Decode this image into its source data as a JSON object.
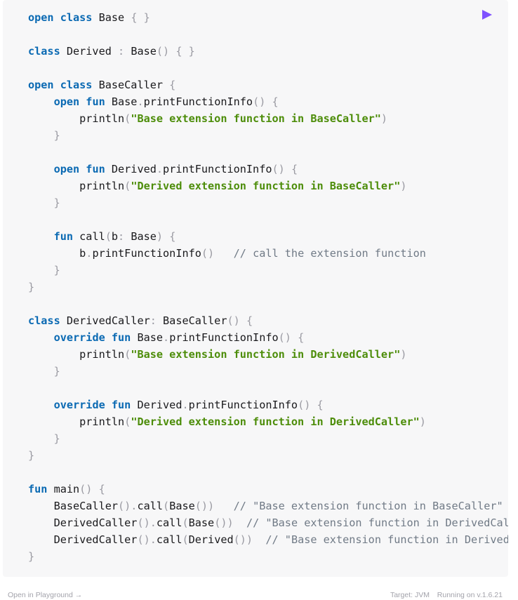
{
  "editor": {
    "run_icon": "play-triangle-icon",
    "accent_color": "#7f52ff",
    "lines": [
      [
        {
          "t": "kw",
          "v": "open class"
        },
        {
          "t": "tx",
          "v": " Base "
        },
        {
          "t": "pn",
          "v": "{ }"
        }
      ],
      [],
      [
        {
          "t": "kw",
          "v": "class"
        },
        {
          "t": "tx",
          "v": " Derived "
        },
        {
          "t": "pn",
          "v": ":"
        },
        {
          "t": "tx",
          "v": " Base"
        },
        {
          "t": "pn",
          "v": "()"
        },
        {
          "t": "tx",
          "v": " "
        },
        {
          "t": "pn",
          "v": "{ }"
        }
      ],
      [],
      [
        {
          "t": "kw",
          "v": "open class"
        },
        {
          "t": "tx",
          "v": " BaseCaller "
        },
        {
          "t": "pn",
          "v": "{"
        }
      ],
      [
        {
          "t": "tx",
          "v": "    "
        },
        {
          "t": "kw",
          "v": "open fun"
        },
        {
          "t": "tx",
          "v": " Base"
        },
        {
          "t": "pn",
          "v": "."
        },
        {
          "t": "tx",
          "v": "printFunctionInfo"
        },
        {
          "t": "pn",
          "v": "()"
        },
        {
          "t": "tx",
          "v": " "
        },
        {
          "t": "pn",
          "v": "{"
        }
      ],
      [
        {
          "t": "tx",
          "v": "        println"
        },
        {
          "t": "pn",
          "v": "("
        },
        {
          "t": "str",
          "v": "\"Base extension function in BaseCaller\""
        },
        {
          "t": "pn",
          "v": ")"
        }
      ],
      [
        {
          "t": "tx",
          "v": "    "
        },
        {
          "t": "pn",
          "v": "}"
        }
      ],
      [],
      [
        {
          "t": "tx",
          "v": "    "
        },
        {
          "t": "kw",
          "v": "open fun"
        },
        {
          "t": "tx",
          "v": " Derived"
        },
        {
          "t": "pn",
          "v": "."
        },
        {
          "t": "tx",
          "v": "printFunctionInfo"
        },
        {
          "t": "pn",
          "v": "()"
        },
        {
          "t": "tx",
          "v": " "
        },
        {
          "t": "pn",
          "v": "{"
        }
      ],
      [
        {
          "t": "tx",
          "v": "        println"
        },
        {
          "t": "pn",
          "v": "("
        },
        {
          "t": "str",
          "v": "\"Derived extension function in BaseCaller\""
        },
        {
          "t": "pn",
          "v": ")"
        }
      ],
      [
        {
          "t": "tx",
          "v": "    "
        },
        {
          "t": "pn",
          "v": "}"
        }
      ],
      [],
      [
        {
          "t": "tx",
          "v": "    "
        },
        {
          "t": "kw",
          "v": "fun"
        },
        {
          "t": "tx",
          "v": " call"
        },
        {
          "t": "pn",
          "v": "("
        },
        {
          "t": "tx",
          "v": "b"
        },
        {
          "t": "pn",
          "v": ":"
        },
        {
          "t": "tx",
          "v": " Base"
        },
        {
          "t": "pn",
          "v": ")"
        },
        {
          "t": "tx",
          "v": " "
        },
        {
          "t": "pn",
          "v": "{"
        }
      ],
      [
        {
          "t": "tx",
          "v": "        b"
        },
        {
          "t": "pn",
          "v": "."
        },
        {
          "t": "tx",
          "v": "printFunctionInfo"
        },
        {
          "t": "pn",
          "v": "()"
        },
        {
          "t": "tx",
          "v": "   "
        },
        {
          "t": "cm",
          "v": "// call the extension function"
        }
      ],
      [
        {
          "t": "tx",
          "v": "    "
        },
        {
          "t": "pn",
          "v": "}"
        }
      ],
      [
        {
          "t": "pn",
          "v": "}"
        }
      ],
      [],
      [
        {
          "t": "kw",
          "v": "class"
        },
        {
          "t": "tx",
          "v": " DerivedCaller"
        },
        {
          "t": "pn",
          "v": ":"
        },
        {
          "t": "tx",
          "v": " BaseCaller"
        },
        {
          "t": "pn",
          "v": "()"
        },
        {
          "t": "tx",
          "v": " "
        },
        {
          "t": "pn",
          "v": "{"
        }
      ],
      [
        {
          "t": "tx",
          "v": "    "
        },
        {
          "t": "kw",
          "v": "override fun"
        },
        {
          "t": "tx",
          "v": " Base"
        },
        {
          "t": "pn",
          "v": "."
        },
        {
          "t": "tx",
          "v": "printFunctionInfo"
        },
        {
          "t": "pn",
          "v": "()"
        },
        {
          "t": "tx",
          "v": " "
        },
        {
          "t": "pn",
          "v": "{"
        }
      ],
      [
        {
          "t": "tx",
          "v": "        println"
        },
        {
          "t": "pn",
          "v": "("
        },
        {
          "t": "str",
          "v": "\"Base extension function in DerivedCaller\""
        },
        {
          "t": "pn",
          "v": ")"
        }
      ],
      [
        {
          "t": "tx",
          "v": "    "
        },
        {
          "t": "pn",
          "v": "}"
        }
      ],
      [],
      [
        {
          "t": "tx",
          "v": "    "
        },
        {
          "t": "kw",
          "v": "override fun"
        },
        {
          "t": "tx",
          "v": " Derived"
        },
        {
          "t": "pn",
          "v": "."
        },
        {
          "t": "tx",
          "v": "printFunctionInfo"
        },
        {
          "t": "pn",
          "v": "()"
        },
        {
          "t": "tx",
          "v": " "
        },
        {
          "t": "pn",
          "v": "{"
        }
      ],
      [
        {
          "t": "tx",
          "v": "        println"
        },
        {
          "t": "pn",
          "v": "("
        },
        {
          "t": "str",
          "v": "\"Derived extension function in DerivedCaller\""
        },
        {
          "t": "pn",
          "v": ")"
        }
      ],
      [
        {
          "t": "tx",
          "v": "    "
        },
        {
          "t": "pn",
          "v": "}"
        }
      ],
      [
        {
          "t": "pn",
          "v": "}"
        }
      ],
      [],
      [
        {
          "t": "kw",
          "v": "fun"
        },
        {
          "t": "tx",
          "v": " main"
        },
        {
          "t": "pn",
          "v": "()"
        },
        {
          "t": "tx",
          "v": " "
        },
        {
          "t": "pn",
          "v": "{"
        }
      ],
      [
        {
          "t": "tx",
          "v": "    BaseCaller"
        },
        {
          "t": "pn",
          "v": "()."
        },
        {
          "t": "tx",
          "v": "call"
        },
        {
          "t": "pn",
          "v": "("
        },
        {
          "t": "tx",
          "v": "Base"
        },
        {
          "t": "pn",
          "v": "())"
        },
        {
          "t": "tx",
          "v": "   "
        },
        {
          "t": "cm",
          "v": "// \"Base extension function in BaseCaller\""
        }
      ],
      [
        {
          "t": "tx",
          "v": "    DerivedCaller"
        },
        {
          "t": "pn",
          "v": "()."
        },
        {
          "t": "tx",
          "v": "call"
        },
        {
          "t": "pn",
          "v": "("
        },
        {
          "t": "tx",
          "v": "Base"
        },
        {
          "t": "pn",
          "v": "())"
        },
        {
          "t": "tx",
          "v": "  "
        },
        {
          "t": "cm",
          "v": "// \"Base extension function in DerivedCal"
        }
      ],
      [
        {
          "t": "tx",
          "v": "    DerivedCaller"
        },
        {
          "t": "pn",
          "v": "()."
        },
        {
          "t": "tx",
          "v": "call"
        },
        {
          "t": "pn",
          "v": "("
        },
        {
          "t": "tx",
          "v": "Derived"
        },
        {
          "t": "pn",
          "v": "())"
        },
        {
          "t": "tx",
          "v": "  "
        },
        {
          "t": "cm",
          "v": "// \"Base extension function in Derived"
        }
      ],
      [
        {
          "t": "pn",
          "v": "}"
        }
      ]
    ]
  },
  "footer": {
    "open_link": "Open in Playground →",
    "target": "Target: JVM",
    "version": "Running on v.1.6.21"
  }
}
